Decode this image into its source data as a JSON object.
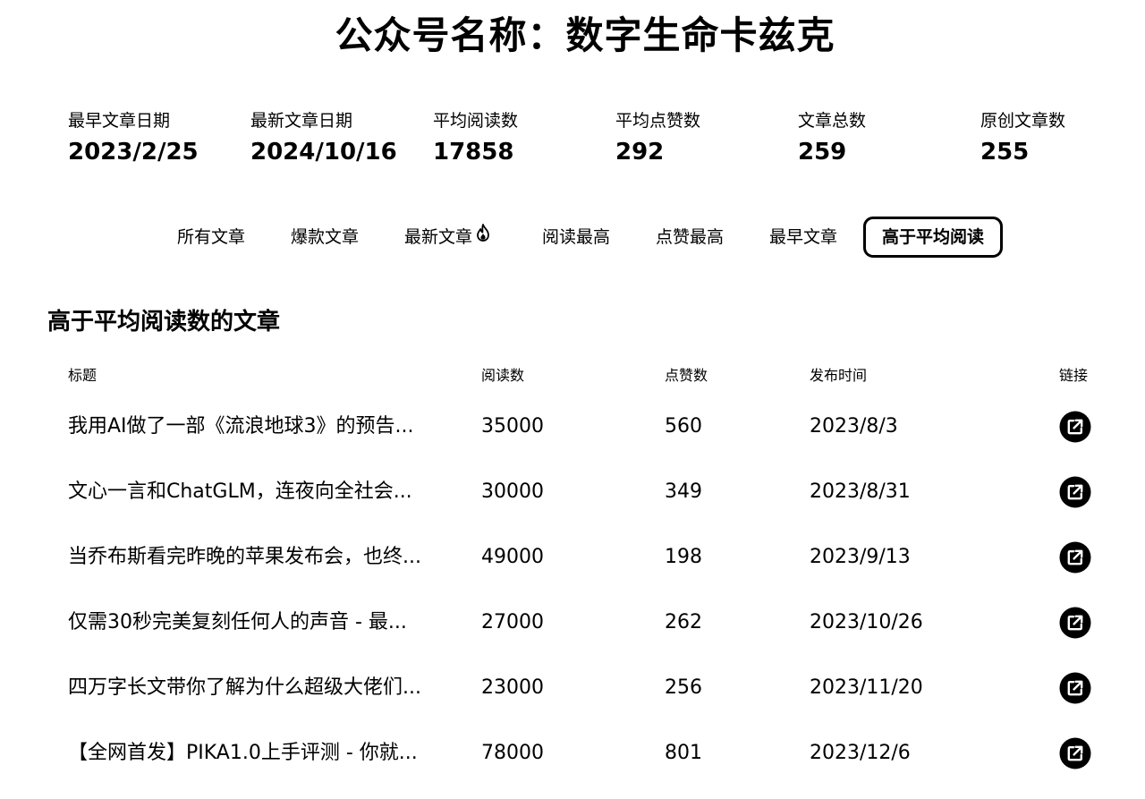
{
  "page": {
    "title": "公众号名称：数字生命卡兹克"
  },
  "stats": [
    {
      "label": "最早文章日期",
      "value": "2023/2/25"
    },
    {
      "label": "最新文章日期",
      "value": "2024/10/16"
    },
    {
      "label": "平均阅读数",
      "value": "17858"
    },
    {
      "label": "平均点赞数",
      "value": "292"
    },
    {
      "label": "文章总数",
      "value": "259"
    },
    {
      "label": "原创文章数",
      "value": "255"
    }
  ],
  "tabs": [
    {
      "label": "所有文章",
      "active": false
    },
    {
      "label": "爆款文章",
      "active": false
    },
    {
      "label": "最新文章",
      "active": false,
      "icon": "flame-icon"
    },
    {
      "label": "阅读最高",
      "active": false
    },
    {
      "label": "点赞最高",
      "active": false
    },
    {
      "label": "最早文章",
      "active": false
    },
    {
      "label": "高于平均阅读",
      "active": true
    }
  ],
  "section": {
    "title": "高于平均阅读数的文章"
  },
  "table": {
    "columns": {
      "title": "标题",
      "reads": "阅读数",
      "likes": "点赞数",
      "date": "发布时间",
      "link": "链接"
    },
    "rows": [
      {
        "title": "我用AI做了一部《流浪地球3》的预告...",
        "reads": "35000",
        "likes": "560",
        "date": "2023/8/3",
        "link_icon": "external-link-icon"
      },
      {
        "title": "文心一言和ChatGLM，连夜向全社会...",
        "reads": "30000",
        "likes": "349",
        "date": "2023/8/31",
        "link_icon": "external-link-icon"
      },
      {
        "title": "当乔布斯看完昨晚的苹果发布会，也终...",
        "reads": "49000",
        "likes": "198",
        "date": "2023/9/13",
        "link_icon": "external-link-icon"
      },
      {
        "title": "仅需30秒完美复刻任何人的声音 - 最...",
        "reads": "27000",
        "likes": "262",
        "date": "2023/10/26",
        "link_icon": "external-link-icon"
      },
      {
        "title": "四万字长文带你了解为什么超级大佬们...",
        "reads": "23000",
        "likes": "256",
        "date": "2023/11/20",
        "link_icon": "external-link-icon"
      },
      {
        "title": "【全网首发】PIKA1.0上手评测 - 你就...",
        "reads": "78000",
        "likes": "801",
        "date": "2023/12/6",
        "link_icon": "external-link-icon"
      }
    ]
  },
  "colors": {
    "text": "#000000",
    "background": "#ffffff",
    "active_tab_border": "#000000"
  }
}
